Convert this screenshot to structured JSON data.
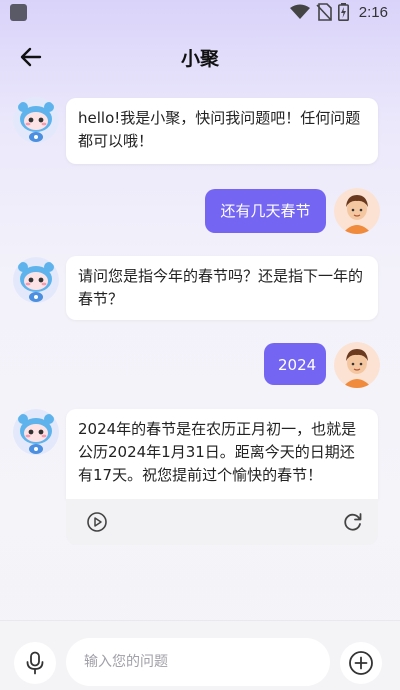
{
  "status_bar": {
    "time": "2:16",
    "icons": [
      "square-icon",
      "wifi-icon",
      "no-sim-icon",
      "battery-icon"
    ]
  },
  "header": {
    "title": "小聚",
    "back_icon": "arrow-left-icon"
  },
  "messages": [
    {
      "role": "bot",
      "text": "hello!我是小聚，快问我问题吧！任何问题都可以哦！"
    },
    {
      "role": "user",
      "text": "还有几天春节"
    },
    {
      "role": "bot",
      "text": "请问您是指今年的春节吗？还是指下一年的春节？"
    },
    {
      "role": "user",
      "text": "2024"
    },
    {
      "role": "bot",
      "text": "2024年的春节是在农历正月初一，也就是公历2024年1月31日。距离今天的日期还有17天。祝您提前过个愉快的春节！",
      "actions": [
        "play-icon",
        "refresh-icon"
      ]
    }
  ],
  "input_bar": {
    "placeholder": "输入您的问题",
    "left_icon": "microphone-icon",
    "right_icon": "plus-circle-icon"
  },
  "colors": {
    "accent": "#7466f2",
    "user_bubble": "#7466f2",
    "bot_bubble": "#ffffff",
    "background_top": "#d9d3fa"
  }
}
